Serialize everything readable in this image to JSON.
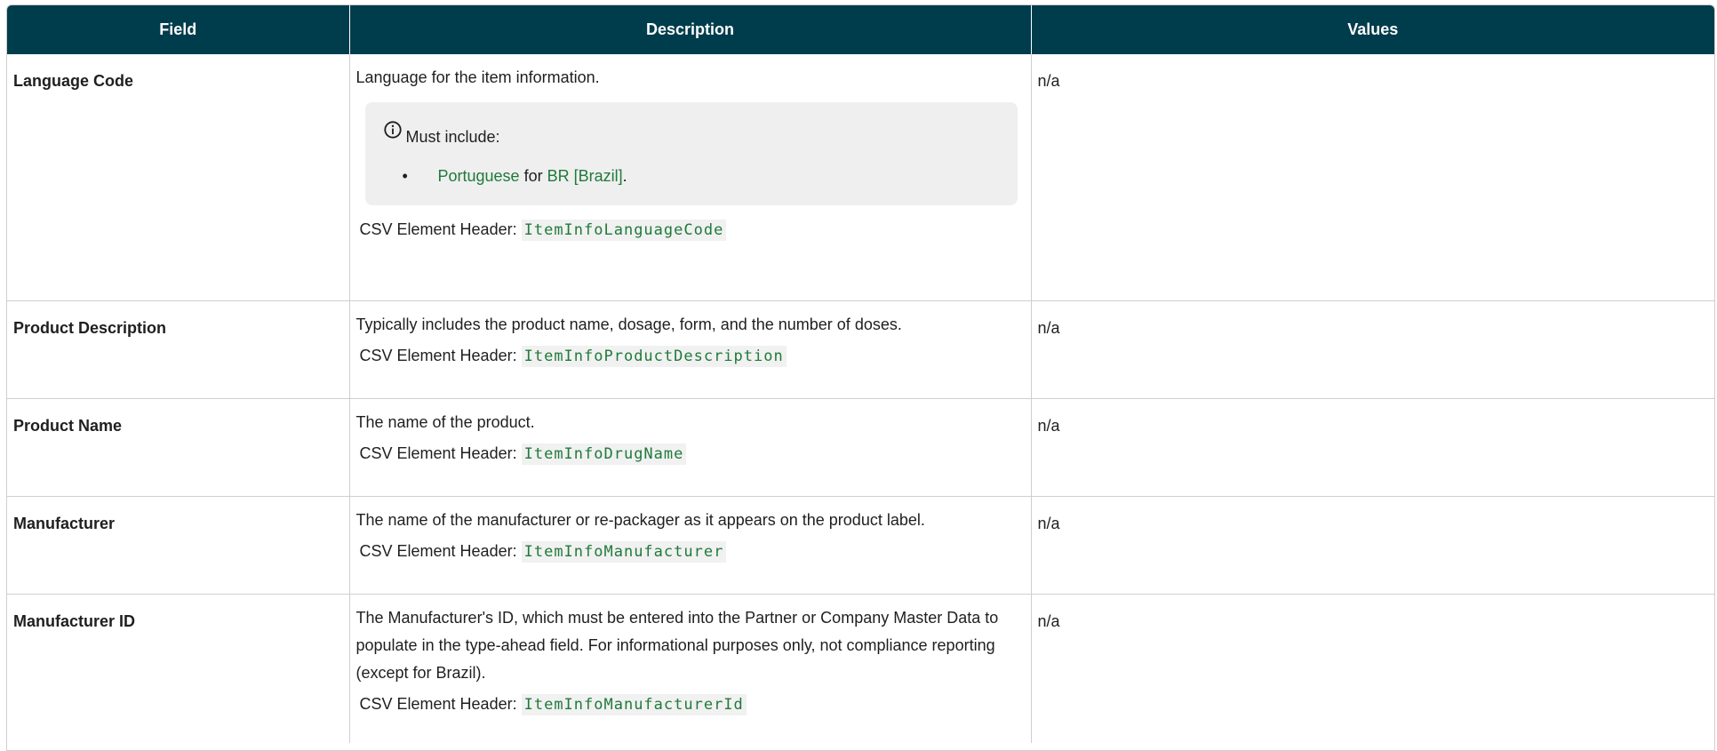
{
  "header": {
    "field": "Field",
    "description": "Description",
    "values": "Values"
  },
  "csv_prefix": "CSV Element Header:",
  "rows": [
    {
      "field": "Language Code",
      "description": "Language for the item information.",
      "note": {
        "icon": "info-circle-icon",
        "heading": "Must include:",
        "items": [
          {
            "link1": "Portuguese",
            "mid": "for",
            "link2": "BR [Brazil]",
            "end": "."
          }
        ]
      },
      "csv": "ItemInfoLanguageCode",
      "values": "n/a"
    },
    {
      "field": "Product Description",
      "description": "Typically includes the product name, dosage, form, and the number of doses.",
      "csv": "ItemInfoProductDescription",
      "values": "n/a"
    },
    {
      "field": "Product Name",
      "description": "The name of the product.",
      "csv": "ItemInfoDrugName",
      "values": "n/a"
    },
    {
      "field": "Manufacturer",
      "description": "The name of the manufacturer or re-packager as it appears on the product label.",
      "csv": "ItemInfoManufacturer",
      "values": "n/a"
    },
    {
      "field": "Manufacturer ID",
      "description": "The Manufacturer's ID, which must be entered into the Partner or Company Master Data to populate in the type-ahead field. For informational purposes only, not compliance reporting (except for Brazil).",
      "csv": "ItemInfoManufacturerId",
      "values": "n/a"
    }
  ],
  "colors": {
    "header_bg": "#003d4c",
    "link_green": "#1f7a3a",
    "note_bg": "#efefef"
  }
}
